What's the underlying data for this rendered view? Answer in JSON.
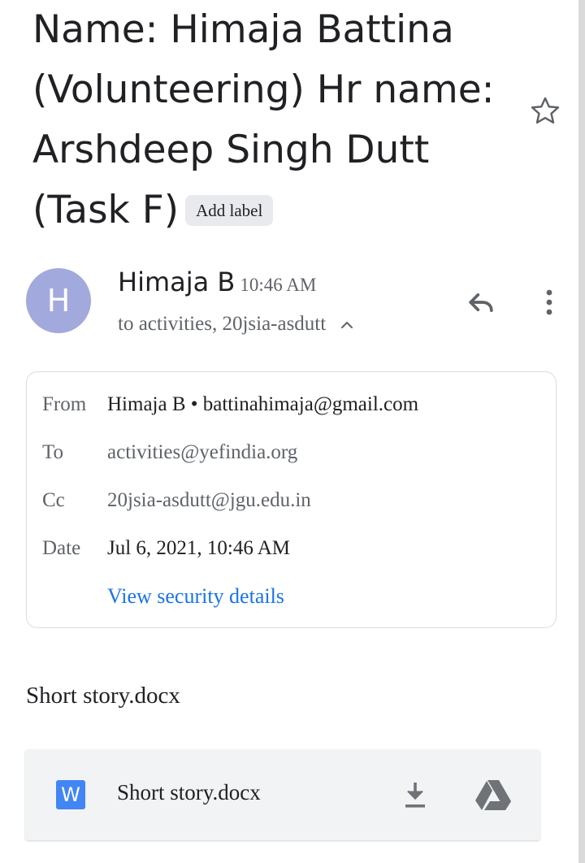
{
  "subject": {
    "lines": [
      "Name: Himaja Battina",
      "(Volunteering) Hr name:",
      "Arshdeep Singh Dutt",
      "(Task F)"
    ],
    "add_label": "Add label"
  },
  "icons": {
    "star": "star-outline-icon",
    "reply": "reply-icon",
    "more": "more-vert-icon",
    "chevron": "chevron-up-icon",
    "word": "word-doc-icon",
    "download": "download-icon",
    "drive": "drive-icon"
  },
  "message": {
    "avatar_letter": "H",
    "avatar_color": "#a2a9dc",
    "sender_name": "Himaja B",
    "time": "10:46 AM",
    "recipients": "to activities, 20jsia-asdutt"
  },
  "details": {
    "from_label": "From",
    "from_value": "Himaja B • battinahimaja@gmail.com",
    "to_label": "To",
    "to_value": "activities@yefindia.org",
    "cc_label": "Cc",
    "cc_value": "20jsia-asdutt@jgu.edu.in",
    "date_label": "Date",
    "date_value": "Jul 6, 2021, 10:46 AM",
    "security_link": "View security details"
  },
  "attachment": {
    "title": "Short story.docx",
    "icon_letter": "W",
    "file_name": "Short story.docx"
  },
  "colors": {
    "link": "#1a73e8",
    "word_blue": "#4285f4",
    "secondary_text": "#5f6368"
  }
}
